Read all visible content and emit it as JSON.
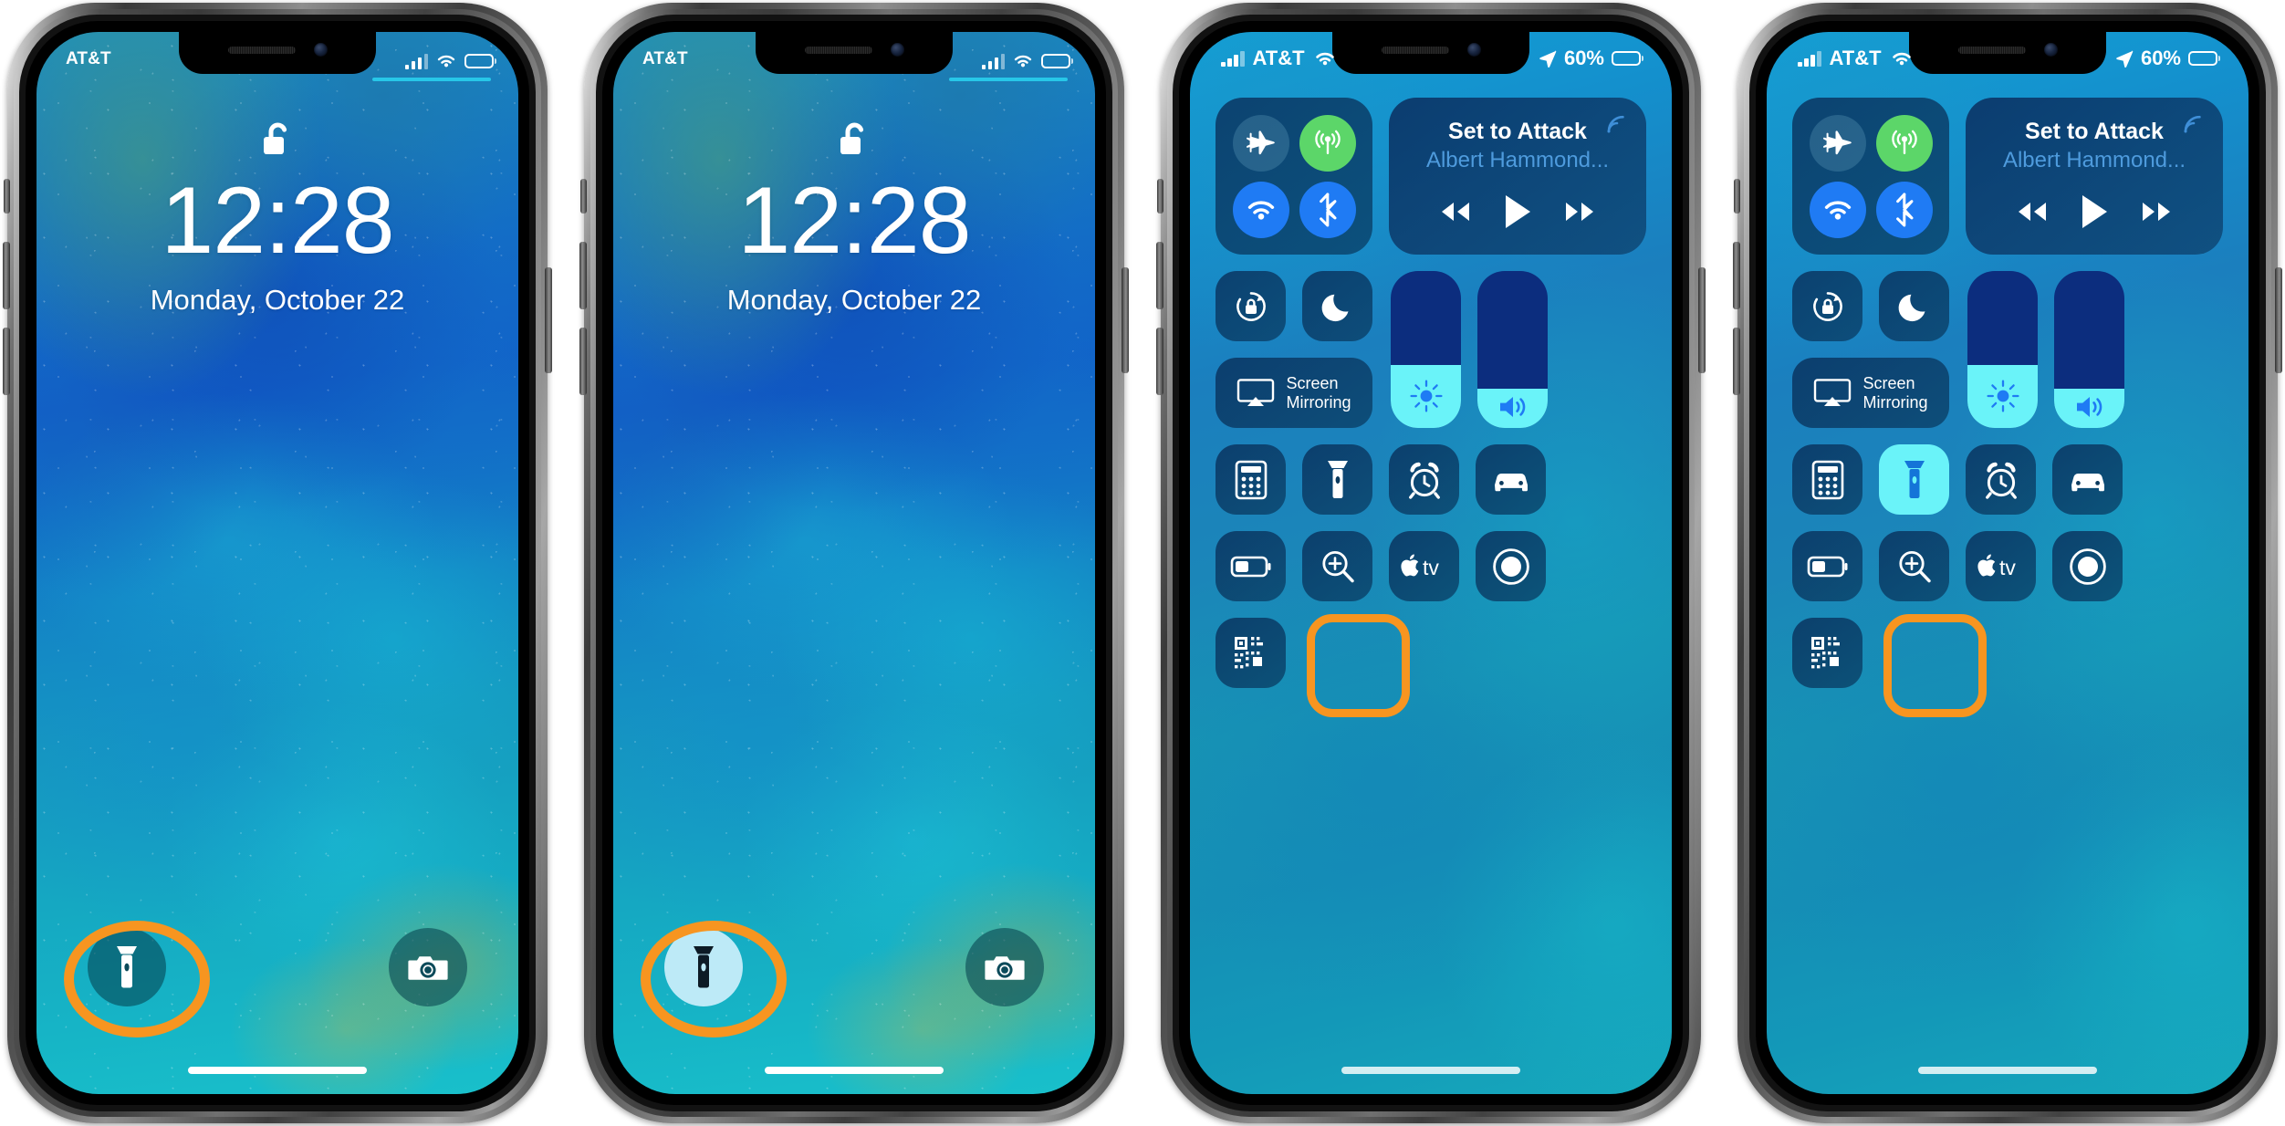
{
  "accent": {
    "highlight_ring": "#f79520",
    "flashlight_on_bg": "#bdeaf7",
    "tile_on_bg": "#6af3f9"
  },
  "phones": [
    {
      "id": "phone-1",
      "kind": "lock-screen",
      "caption_role": "lock-screen-flashlight-off",
      "status_bar": {
        "carrier": "AT&T",
        "signal_icon": "signal-bars-icon",
        "wifi_icon": "wifi-icon",
        "battery_icon": "battery-icon"
      },
      "lock_icon": "unlock-icon",
      "time": "12:28",
      "date": "Monday, October 22",
      "left_action": {
        "icon": "flashlight-icon",
        "state": "off",
        "highlighted": true
      },
      "right_action": {
        "icon": "camera-icon",
        "state": "off",
        "highlighted": false
      }
    },
    {
      "id": "phone-2",
      "kind": "lock-screen",
      "caption_role": "lock-screen-flashlight-on",
      "status_bar": {
        "carrier": "AT&T",
        "signal_icon": "signal-bars-icon",
        "wifi_icon": "wifi-icon",
        "battery_icon": "battery-icon"
      },
      "lock_icon": "unlock-icon",
      "time": "12:28",
      "date": "Monday, October 22",
      "left_action": {
        "icon": "flashlight-icon",
        "state": "on",
        "highlighted": true
      },
      "right_action": {
        "icon": "camera-icon",
        "state": "off",
        "highlighted": false
      }
    },
    {
      "id": "phone-3",
      "kind": "control-center",
      "caption_role": "control-center-flashlight-off",
      "status_bar": {
        "carrier": "AT&T",
        "signal_icon": "signal-bars-icon",
        "wifi_icon": "wifi-icon",
        "location_icon": "location-arrow-icon",
        "battery_percent": "60%",
        "battery_icon": "battery-icon"
      },
      "connectivity": [
        {
          "name": "airplane-mode",
          "icon": "airplane-icon",
          "state": "off"
        },
        {
          "name": "cellular-data",
          "icon": "cellular-antenna-icon",
          "state": "on"
        },
        {
          "name": "wifi",
          "icon": "wifi-icon",
          "state": "on"
        },
        {
          "name": "bluetooth",
          "icon": "bluetooth-icon",
          "state": "on"
        }
      ],
      "now_playing": {
        "title": "Set to Attack",
        "artist": "Albert Hammond...",
        "airplay_icon": "airplay-audio-icon",
        "controls": [
          {
            "name": "rewind-button",
            "icon": "rewind-icon"
          },
          {
            "name": "play-button",
            "icon": "play-icon"
          },
          {
            "name": "fast-forward-button",
            "icon": "fast-forward-icon"
          }
        ]
      },
      "rotation_lock": {
        "icon": "rotation-lock-icon",
        "state": "off"
      },
      "do_not_disturb": {
        "icon": "moon-icon",
        "state": "off"
      },
      "screen_mirroring": {
        "icon": "screen-mirroring-icon",
        "label_line1": "Screen",
        "label_line2": "Mirroring"
      },
      "brightness": {
        "icon": "brightness-sun-icon",
        "percent": 40
      },
      "volume": {
        "icon": "volume-speaker-icon",
        "percent": 25
      },
      "tiles_row1": [
        {
          "name": "calculator",
          "icon": "calculator-icon",
          "state": "off",
          "highlighted": false
        },
        {
          "name": "flashlight",
          "icon": "flashlight-icon",
          "state": "off",
          "highlighted": true
        },
        {
          "name": "alarm",
          "icon": "alarm-clock-icon",
          "state": "off",
          "highlighted": false
        },
        {
          "name": "do-not-disturb-while-driving",
          "icon": "car-icon",
          "state": "off",
          "highlighted": false
        }
      ],
      "tiles_row2": [
        {
          "name": "low-power-mode",
          "icon": "low-power-battery-icon",
          "state": "off",
          "highlighted": false
        },
        {
          "name": "magnifier",
          "icon": "magnifier-icon",
          "state": "off",
          "highlighted": false
        },
        {
          "name": "apple-tv-remote",
          "icon": "apple-tv-icon",
          "state": "off",
          "highlighted": false
        },
        {
          "name": "screen-recording",
          "icon": "screen-record-icon",
          "state": "off",
          "highlighted": false
        }
      ],
      "tiles_row3": [
        {
          "name": "qr-code-scanner",
          "icon": "qr-code-icon",
          "state": "off",
          "highlighted": false
        }
      ]
    },
    {
      "id": "phone-4",
      "kind": "control-center",
      "caption_role": "control-center-flashlight-on",
      "status_bar": {
        "carrier": "AT&T",
        "signal_icon": "signal-bars-icon",
        "wifi_icon": "wifi-icon",
        "location_icon": "location-arrow-icon",
        "battery_percent": "60%",
        "battery_icon": "battery-icon"
      },
      "connectivity": [
        {
          "name": "airplane-mode",
          "icon": "airplane-icon",
          "state": "off"
        },
        {
          "name": "cellular-data",
          "icon": "cellular-antenna-icon",
          "state": "on"
        },
        {
          "name": "wifi",
          "icon": "wifi-icon",
          "state": "on"
        },
        {
          "name": "bluetooth",
          "icon": "bluetooth-icon",
          "state": "on"
        }
      ],
      "now_playing": {
        "title": "Set to Attack",
        "artist": "Albert Hammond...",
        "airplay_icon": "airplay-audio-icon",
        "controls": [
          {
            "name": "rewind-button",
            "icon": "rewind-icon"
          },
          {
            "name": "play-button",
            "icon": "play-icon"
          },
          {
            "name": "fast-forward-button",
            "icon": "fast-forward-icon"
          }
        ]
      },
      "rotation_lock": {
        "icon": "rotation-lock-icon",
        "state": "off"
      },
      "do_not_disturb": {
        "icon": "moon-icon",
        "state": "off"
      },
      "screen_mirroring": {
        "icon": "screen-mirroring-icon",
        "label_line1": "Screen",
        "label_line2": "Mirroring"
      },
      "brightness": {
        "icon": "brightness-sun-icon",
        "percent": 40
      },
      "volume": {
        "icon": "volume-speaker-icon",
        "percent": 25
      },
      "tiles_row1": [
        {
          "name": "calculator",
          "icon": "calculator-icon",
          "state": "off",
          "highlighted": false
        },
        {
          "name": "flashlight",
          "icon": "flashlight-icon",
          "state": "on",
          "highlighted": true
        },
        {
          "name": "alarm",
          "icon": "alarm-clock-icon",
          "state": "off",
          "highlighted": false
        },
        {
          "name": "do-not-disturb-while-driving",
          "icon": "car-icon",
          "state": "off",
          "highlighted": false
        }
      ],
      "tiles_row2": [
        {
          "name": "low-power-mode",
          "icon": "low-power-battery-icon",
          "state": "off",
          "highlighted": false
        },
        {
          "name": "magnifier",
          "icon": "magnifier-icon",
          "state": "off",
          "highlighted": false
        },
        {
          "name": "apple-tv-remote",
          "icon": "apple-tv-icon",
          "state": "off",
          "highlighted": false
        },
        {
          "name": "screen-recording",
          "icon": "screen-record-icon",
          "state": "off",
          "highlighted": false
        }
      ],
      "tiles_row3": [
        {
          "name": "qr-code-scanner",
          "icon": "qr-code-icon",
          "state": "off",
          "highlighted": false
        }
      ]
    }
  ]
}
